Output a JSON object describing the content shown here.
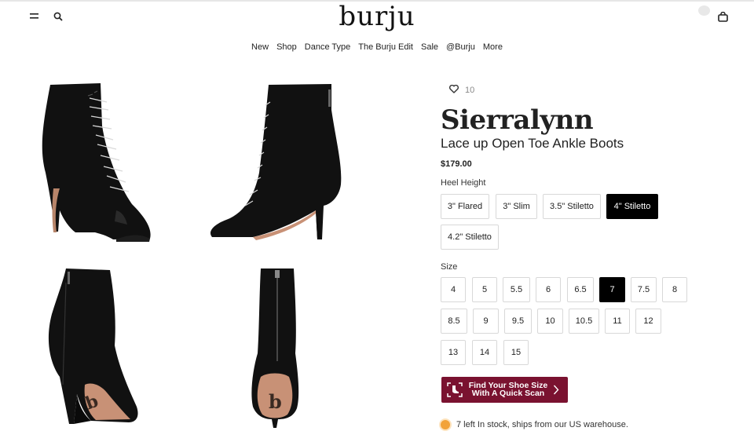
{
  "header": {
    "logo": "burju",
    "icons": [
      "menu-icon",
      "search-icon",
      "bag-icon"
    ]
  },
  "nav": {
    "items": [
      "New",
      "Shop",
      "Dance Type",
      "The Burju Edit",
      "Sale",
      "@Burju",
      "More"
    ]
  },
  "gallery": {
    "images": [
      "boot-side-lace",
      "boot-side-outer",
      "boot-back-left",
      "boot-back"
    ]
  },
  "product": {
    "favorites_count": "10",
    "brand": "Sierralynn",
    "name": "Lace up Open Toe Ankle Boots",
    "price": "$179.00"
  },
  "heel_height": {
    "label": "Heel Height",
    "options": [
      "3\" Flared",
      "3\" Slim",
      "3.5\" Stiletto",
      "4\" Stiletto",
      "4.2\" Stiletto"
    ],
    "selected": "4\" Stiletto"
  },
  "size": {
    "label": "Size",
    "options": [
      "4",
      "5",
      "5.5",
      "6",
      "6.5",
      "7",
      "7.5",
      "8",
      "8.5",
      "9",
      "9.5",
      "10",
      "10.5",
      "11",
      "12",
      "13",
      "14",
      "15"
    ],
    "selected": "7"
  },
  "scan": {
    "line1": "Find Your Shoe Size",
    "line2": "With A Quick Scan",
    "color": "#7a1230"
  },
  "stock": {
    "text": "7 left In stock, ships from our US warehouse.",
    "dot_color": "#f2a33a"
  }
}
